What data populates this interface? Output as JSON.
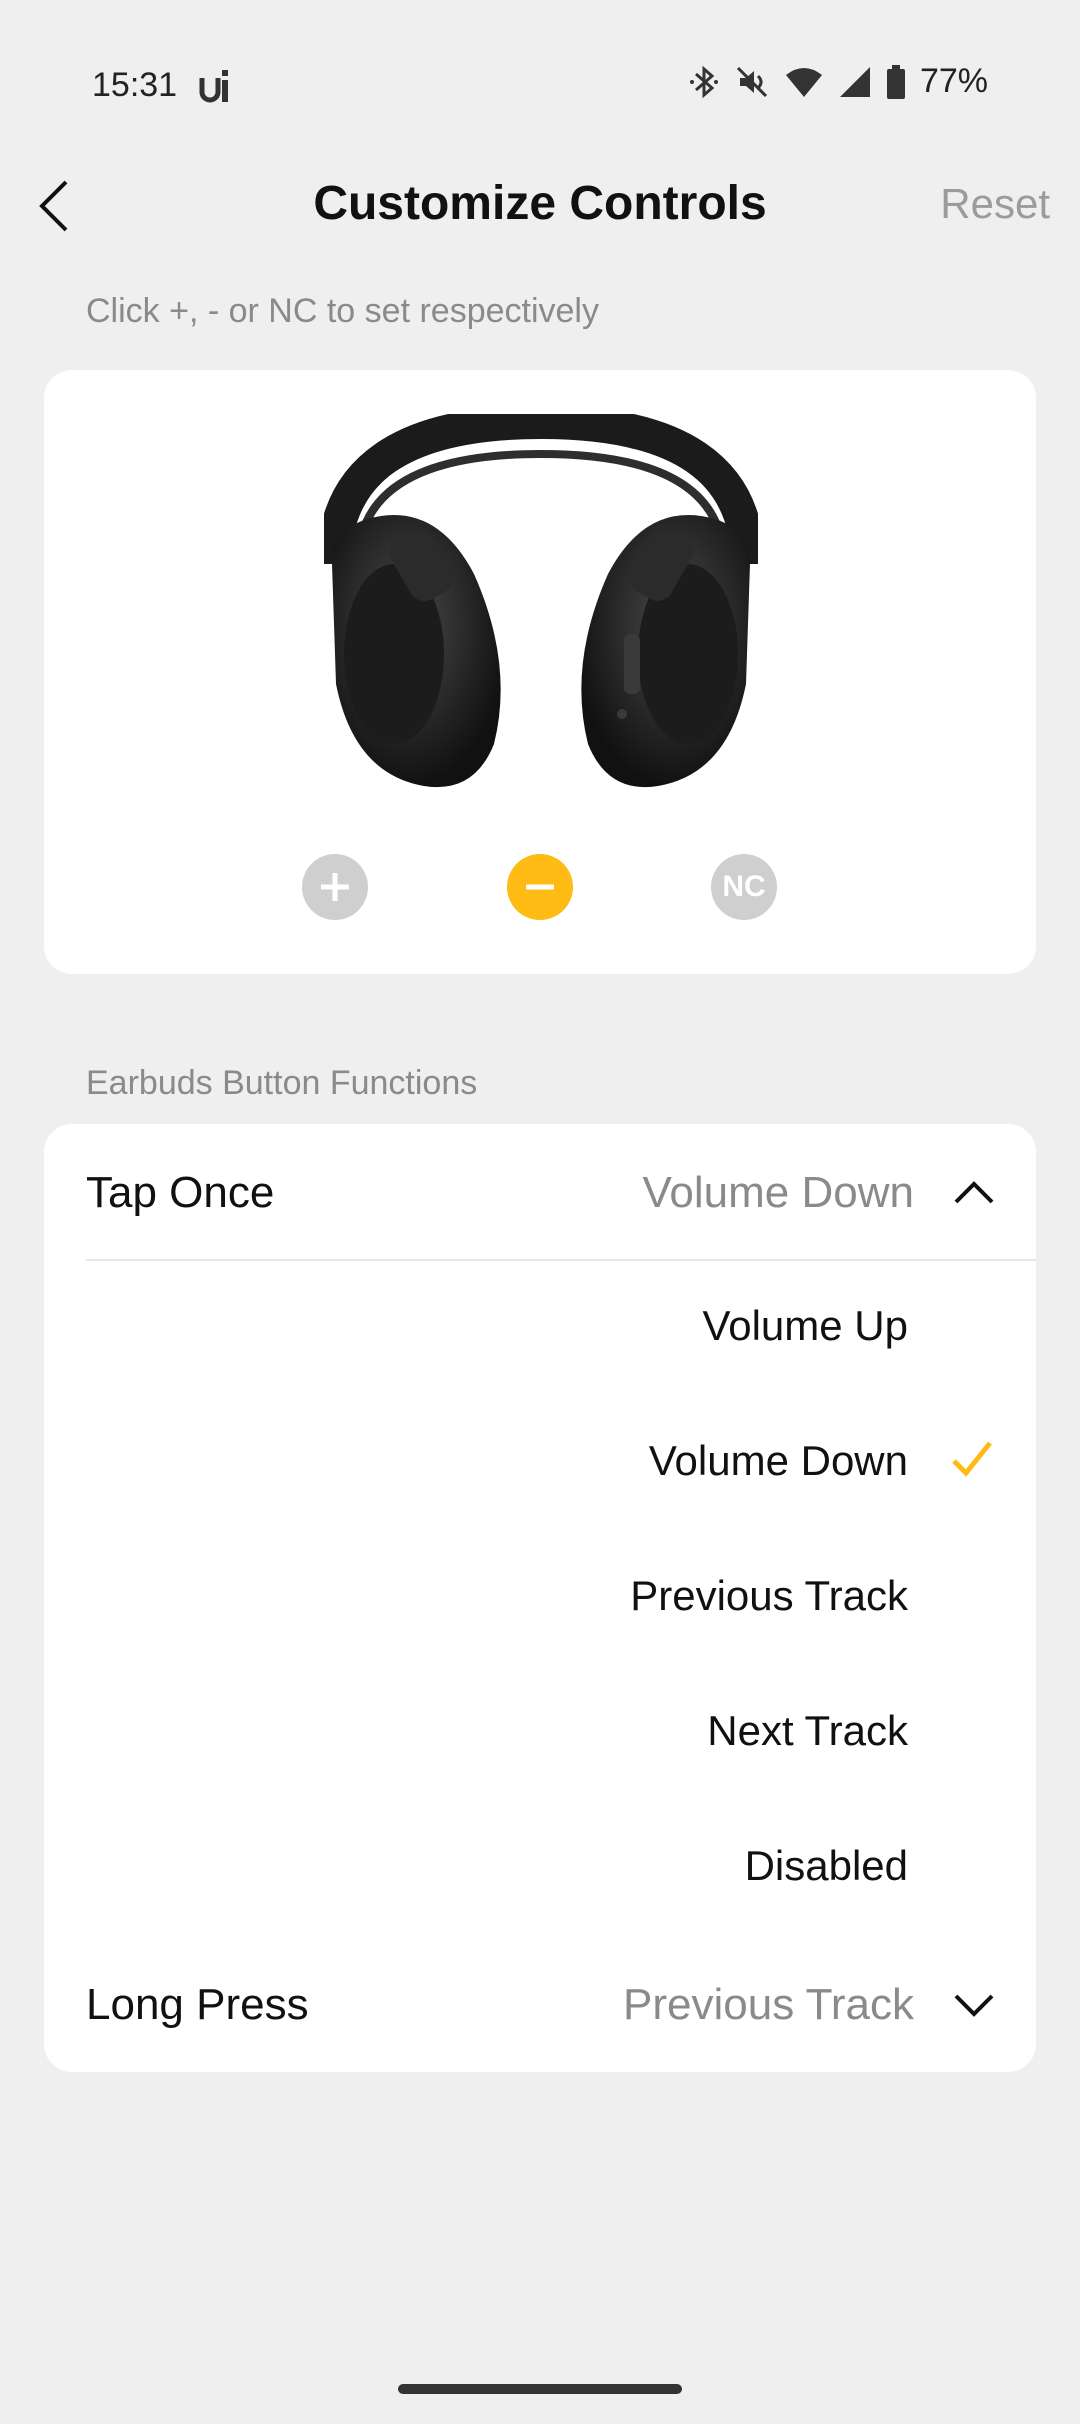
{
  "status_bar": {
    "time": "15:31",
    "battery": "77%",
    "icons": [
      "u-app-icon",
      "bluetooth-icon",
      "mute-icon",
      "wifi-icon",
      "signal-icon",
      "battery-icon"
    ]
  },
  "header": {
    "title": "Customize Controls",
    "reset_label": "Reset"
  },
  "hint": "Click +, - or NC to set respectively",
  "controls": {
    "plus_selected": false,
    "minus_selected": true,
    "nc_label": "NC",
    "nc_selected": false,
    "accent_color": "#fdbb14",
    "inactive_color": "#cfcfcf"
  },
  "section_label": "Earbuds Button Functions",
  "tap_once": {
    "label": "Tap Once",
    "value": "Volume Down",
    "expanded": true
  },
  "options": [
    {
      "label": "Volume Up",
      "selected": false
    },
    {
      "label": "Volume Down",
      "selected": true
    },
    {
      "label": "Previous Track",
      "selected": false
    },
    {
      "label": "Next Track",
      "selected": false
    },
    {
      "label": "Disabled",
      "selected": false
    }
  ],
  "long_press": {
    "label": "Long Press",
    "value": "Previous Track",
    "expanded": false
  }
}
